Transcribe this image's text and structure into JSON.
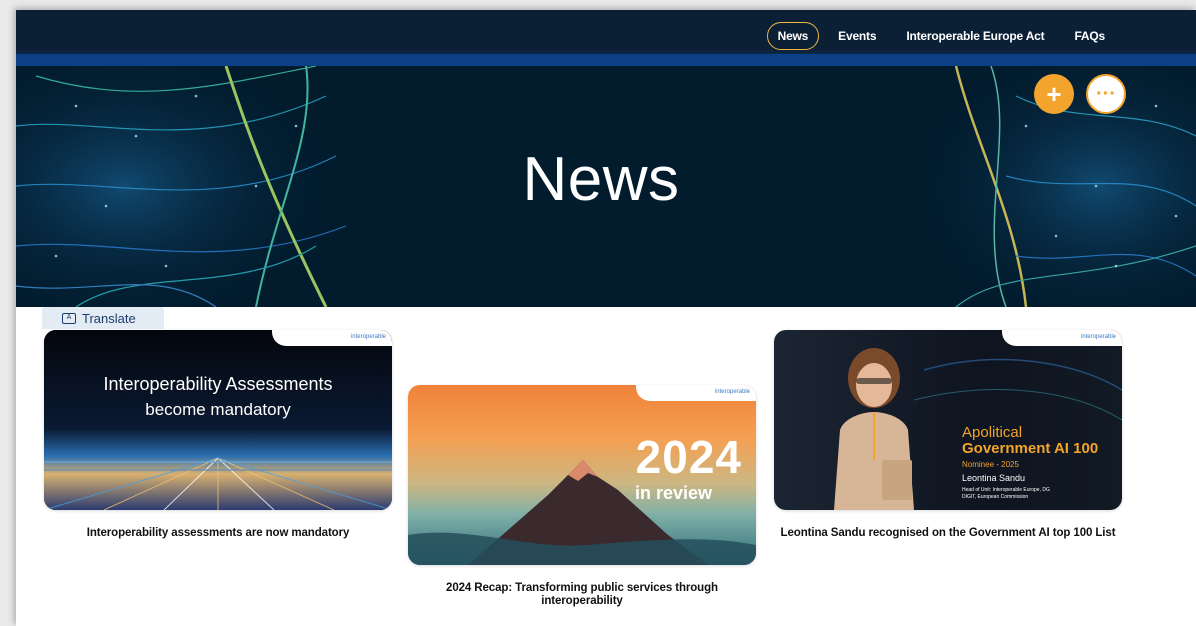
{
  "nav": {
    "items": [
      {
        "label": "News",
        "active": true
      },
      {
        "label": "Events"
      },
      {
        "label": "Interoperable Europe Act"
      },
      {
        "label": "FAQs"
      }
    ]
  },
  "hero": {
    "title": "News",
    "add_icon": "plus-icon",
    "more_icon": "more-horizontal-icon"
  },
  "translate": {
    "label": "Translate",
    "icon": "translate-icon"
  },
  "cards": [
    {
      "image_brand": "interoperable",
      "image_line1": "Interoperability Assessments",
      "image_line2": "become mandatory",
      "caption": "Interoperability assessments are now mandatory"
    },
    {
      "image_brand": "interoperable",
      "image_year": "2024",
      "image_sub": "in review",
      "caption": "2024 Recap: Transforming public services through interoperability"
    },
    {
      "image_brand": "interoperable",
      "image_t1": "Apolitical",
      "image_t2": "Government AI 100",
      "image_t3": "Nominee - 2025",
      "image_t4": "Leontina Sandu",
      "image_t5": "Head of Unit: Interoperable Europe, DG DIGIT, European Commission",
      "caption": "Leontina Sandu recognised on the Government AI top 100 List"
    }
  ],
  "colors": {
    "accent": "#f3a42c",
    "nav_bg": "#0c2035",
    "hero_bg": "#021c2e"
  }
}
